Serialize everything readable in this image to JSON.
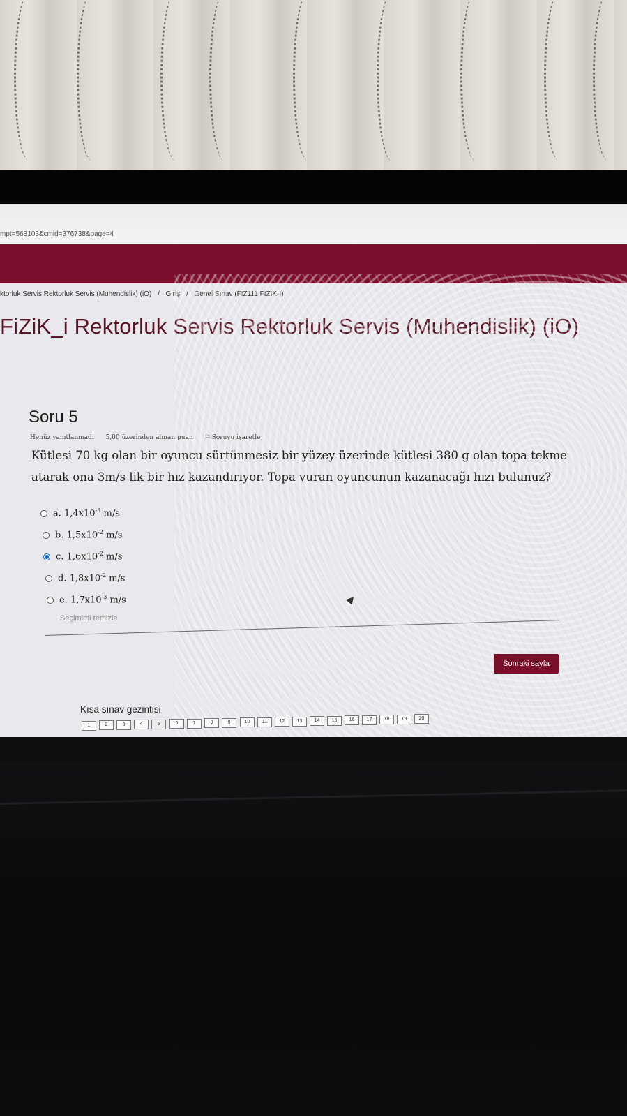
{
  "browser": {
    "url_fragment": "mpt=563103&cmid=376738&page=4"
  },
  "breadcrumb": [
    "ktorluk Servis Rektorluk Servis (Muhendislik) (iO)",
    "/",
    "Giriş",
    "/",
    "Genel Sınav (FİZ111 FİZİK-I)"
  ],
  "course_title": "FiZiK_i Rektorluk Servis Rektorluk Servis (Muhendislik) (iO)",
  "question": {
    "heading": "Soru 5",
    "status": "Henüz yanıtlanmadı",
    "points": "5,00 üzerinden alınan puan",
    "flag": "Soruyu işaretle",
    "text": "Kütlesi 70 kg olan bir oyuncu sürtünmesiz bir yüzey üzerinde kütlesi 380 g olan topa tekme atarak ona 3m/s lik bir hız kazandırıyor. Topa vuran oyuncunun kazanacağı hızı bulunuz?",
    "answers": [
      {
        "prefix": "a. 1,4x10",
        "exp": "-3",
        "unit": " m/s",
        "selected": false
      },
      {
        "prefix": "b. 1,5x10",
        "exp": "-2",
        "unit": " m/s",
        "selected": false
      },
      {
        "prefix": "c. 1,6x10",
        "exp": "-2",
        "unit": " m/s",
        "selected": true
      },
      {
        "prefix": "d. 1,8x10",
        "exp": "-2",
        "unit": " m/s",
        "selected": false
      },
      {
        "prefix": "e. 1,7x10",
        "exp": "-3",
        "unit": " m/s",
        "selected": false
      }
    ],
    "clear_label": "Seçimimi temizle"
  },
  "next_button": "Sonraki sayfa",
  "quiz_nav": {
    "title": "Kısa sınav gezintisi",
    "pages": [
      "1",
      "2",
      "3",
      "4",
      "5",
      "6",
      "7",
      "8",
      "9",
      "10",
      "11",
      "12",
      "13",
      "14",
      "15",
      "16",
      "17",
      "18",
      "19",
      "20"
    ],
    "current": "5"
  },
  "taskbar_icons": [
    "start-icon",
    "taskview-icon",
    "edge-icon",
    "chrome-icon",
    "explorer-icon",
    "mail-icon",
    "office-icon",
    "whatsapp-icon",
    "todo-icon",
    "spotify-icon",
    "store-icon",
    "app-icon"
  ],
  "colors": {
    "brand": "#7d0f2e",
    "title": "#5a1424",
    "radio_selected": "#1467c7"
  }
}
